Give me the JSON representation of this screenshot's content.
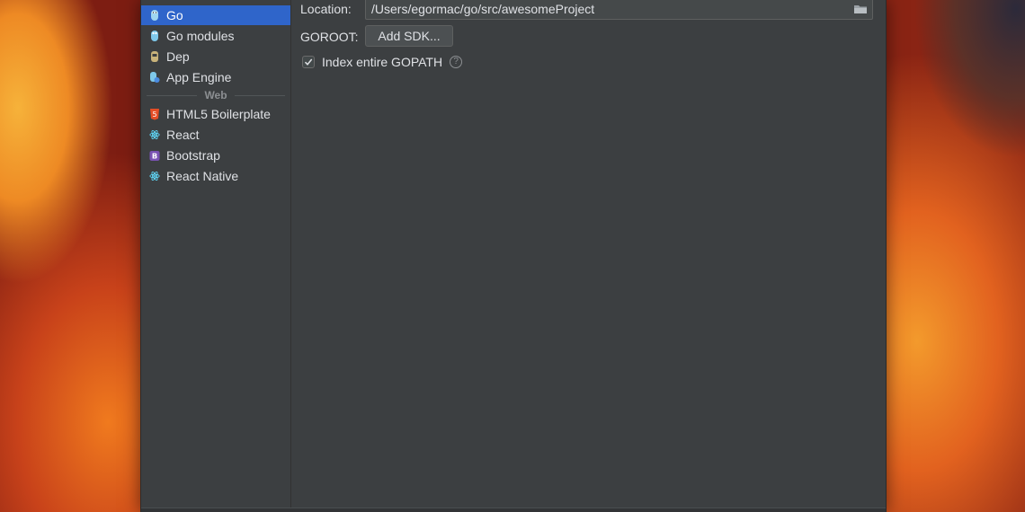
{
  "sidebar": {
    "partial_header": "..",
    "items": [
      {
        "label": "Go",
        "icon": "go-gopher-icon",
        "selected": true
      },
      {
        "label": "Go modules",
        "icon": "go-gopher-icon"
      },
      {
        "label": "Dep",
        "icon": "dep-icon"
      },
      {
        "label": "App Engine",
        "icon": "app-engine-icon"
      }
    ],
    "web_group": {
      "header": "Web",
      "items": [
        {
          "label": "HTML5 Boilerplate",
          "icon": "html5-icon"
        },
        {
          "label": "React",
          "icon": "react-icon"
        },
        {
          "label": "Bootstrap",
          "icon": "bootstrap-icon"
        },
        {
          "label": "React Native",
          "icon": "react-icon"
        }
      ]
    }
  },
  "form": {
    "location_label": "Location:",
    "location_value": "/Users/egormac/go/src/awesomeProject",
    "goroot_label": "GOROOT:",
    "add_sdk_label": "Add SDK...",
    "index_gopath_label": "Index entire GOPATH",
    "index_gopath_checked": true
  },
  "colors": {
    "dialog_bg": "#3c3f41",
    "selection": "#2f65ca",
    "text": "#dfe1e5",
    "muted_text": "#8c8f92"
  }
}
